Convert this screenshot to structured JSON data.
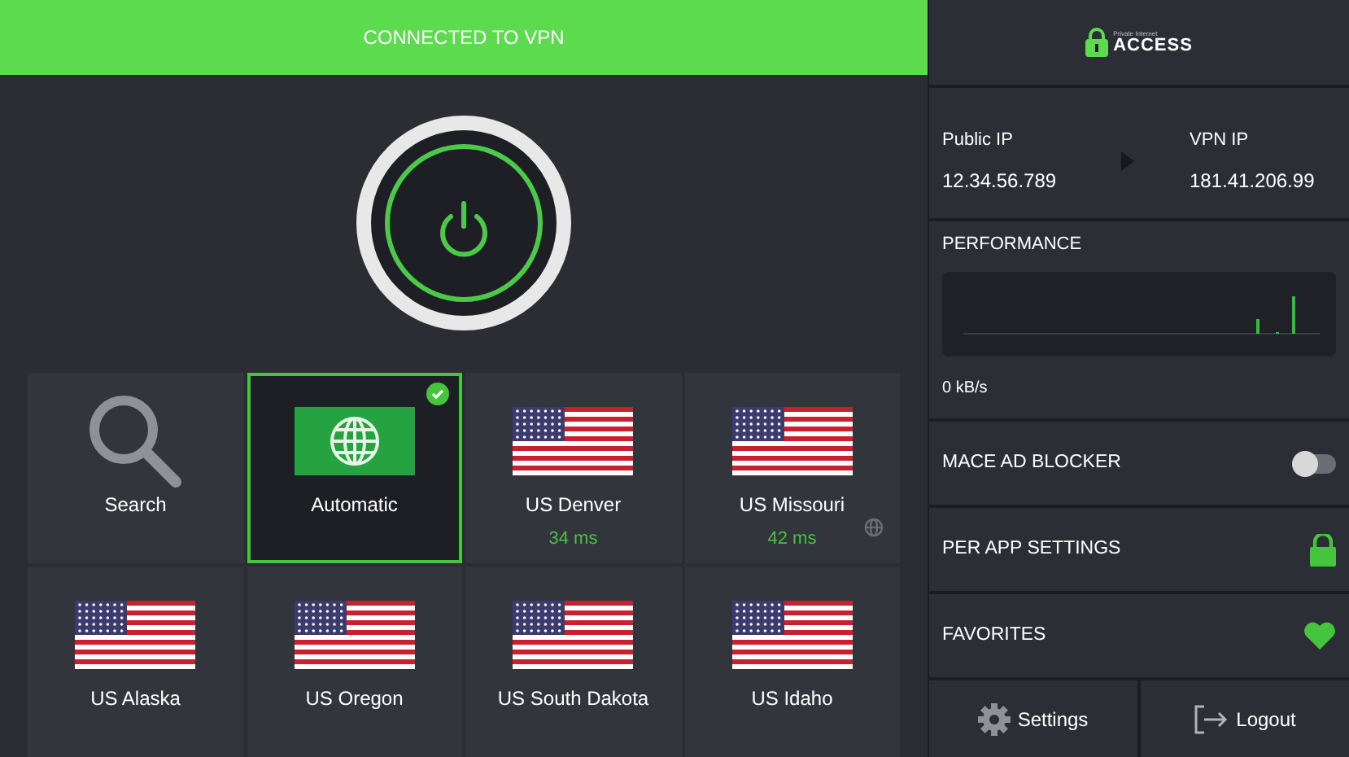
{
  "status_banner": {
    "text": "CONNECTED TO VPN",
    "connected": true
  },
  "logo": {
    "small_text": "Private Internet",
    "brand": "ACCESS"
  },
  "ip": {
    "public_label": "Public IP",
    "public_value": "12.34.56.789",
    "vpn_label": "VPN IP",
    "vpn_value": "181.41.206.99"
  },
  "performance": {
    "title": "PERFORMANCE",
    "reading": "0 kB/s"
  },
  "servers": [
    {
      "kind": "search",
      "name": "Search",
      "selected": false
    },
    {
      "kind": "auto",
      "name": "Automatic",
      "selected": true
    },
    {
      "kind": "server",
      "name": "US Denver",
      "latency": "34 ms",
      "selected": false,
      "geo": false
    },
    {
      "kind": "server",
      "name": "US Missouri",
      "latency": "42 ms",
      "selected": false,
      "geo": true
    },
    {
      "kind": "server",
      "name": "US Alaska",
      "selected": false,
      "geo": false
    },
    {
      "kind": "server",
      "name": "US Oregon",
      "selected": false,
      "geo": false
    },
    {
      "kind": "server",
      "name": "US South Dakota",
      "selected": false,
      "geo": false
    },
    {
      "kind": "server",
      "name": "US Idaho",
      "selected": false,
      "geo": false
    }
  ],
  "options": [
    {
      "kind": "toggle",
      "label": "MACE AD BLOCKER",
      "on": false
    },
    {
      "kind": "lock",
      "label": "PER APP SETTINGS"
    },
    {
      "kind": "heart",
      "label": "FAVORITES"
    }
  ],
  "buttons": [
    {
      "kind": "settings",
      "label": "Settings"
    },
    {
      "kind": "logout",
      "label": "Logout"
    }
  ]
}
